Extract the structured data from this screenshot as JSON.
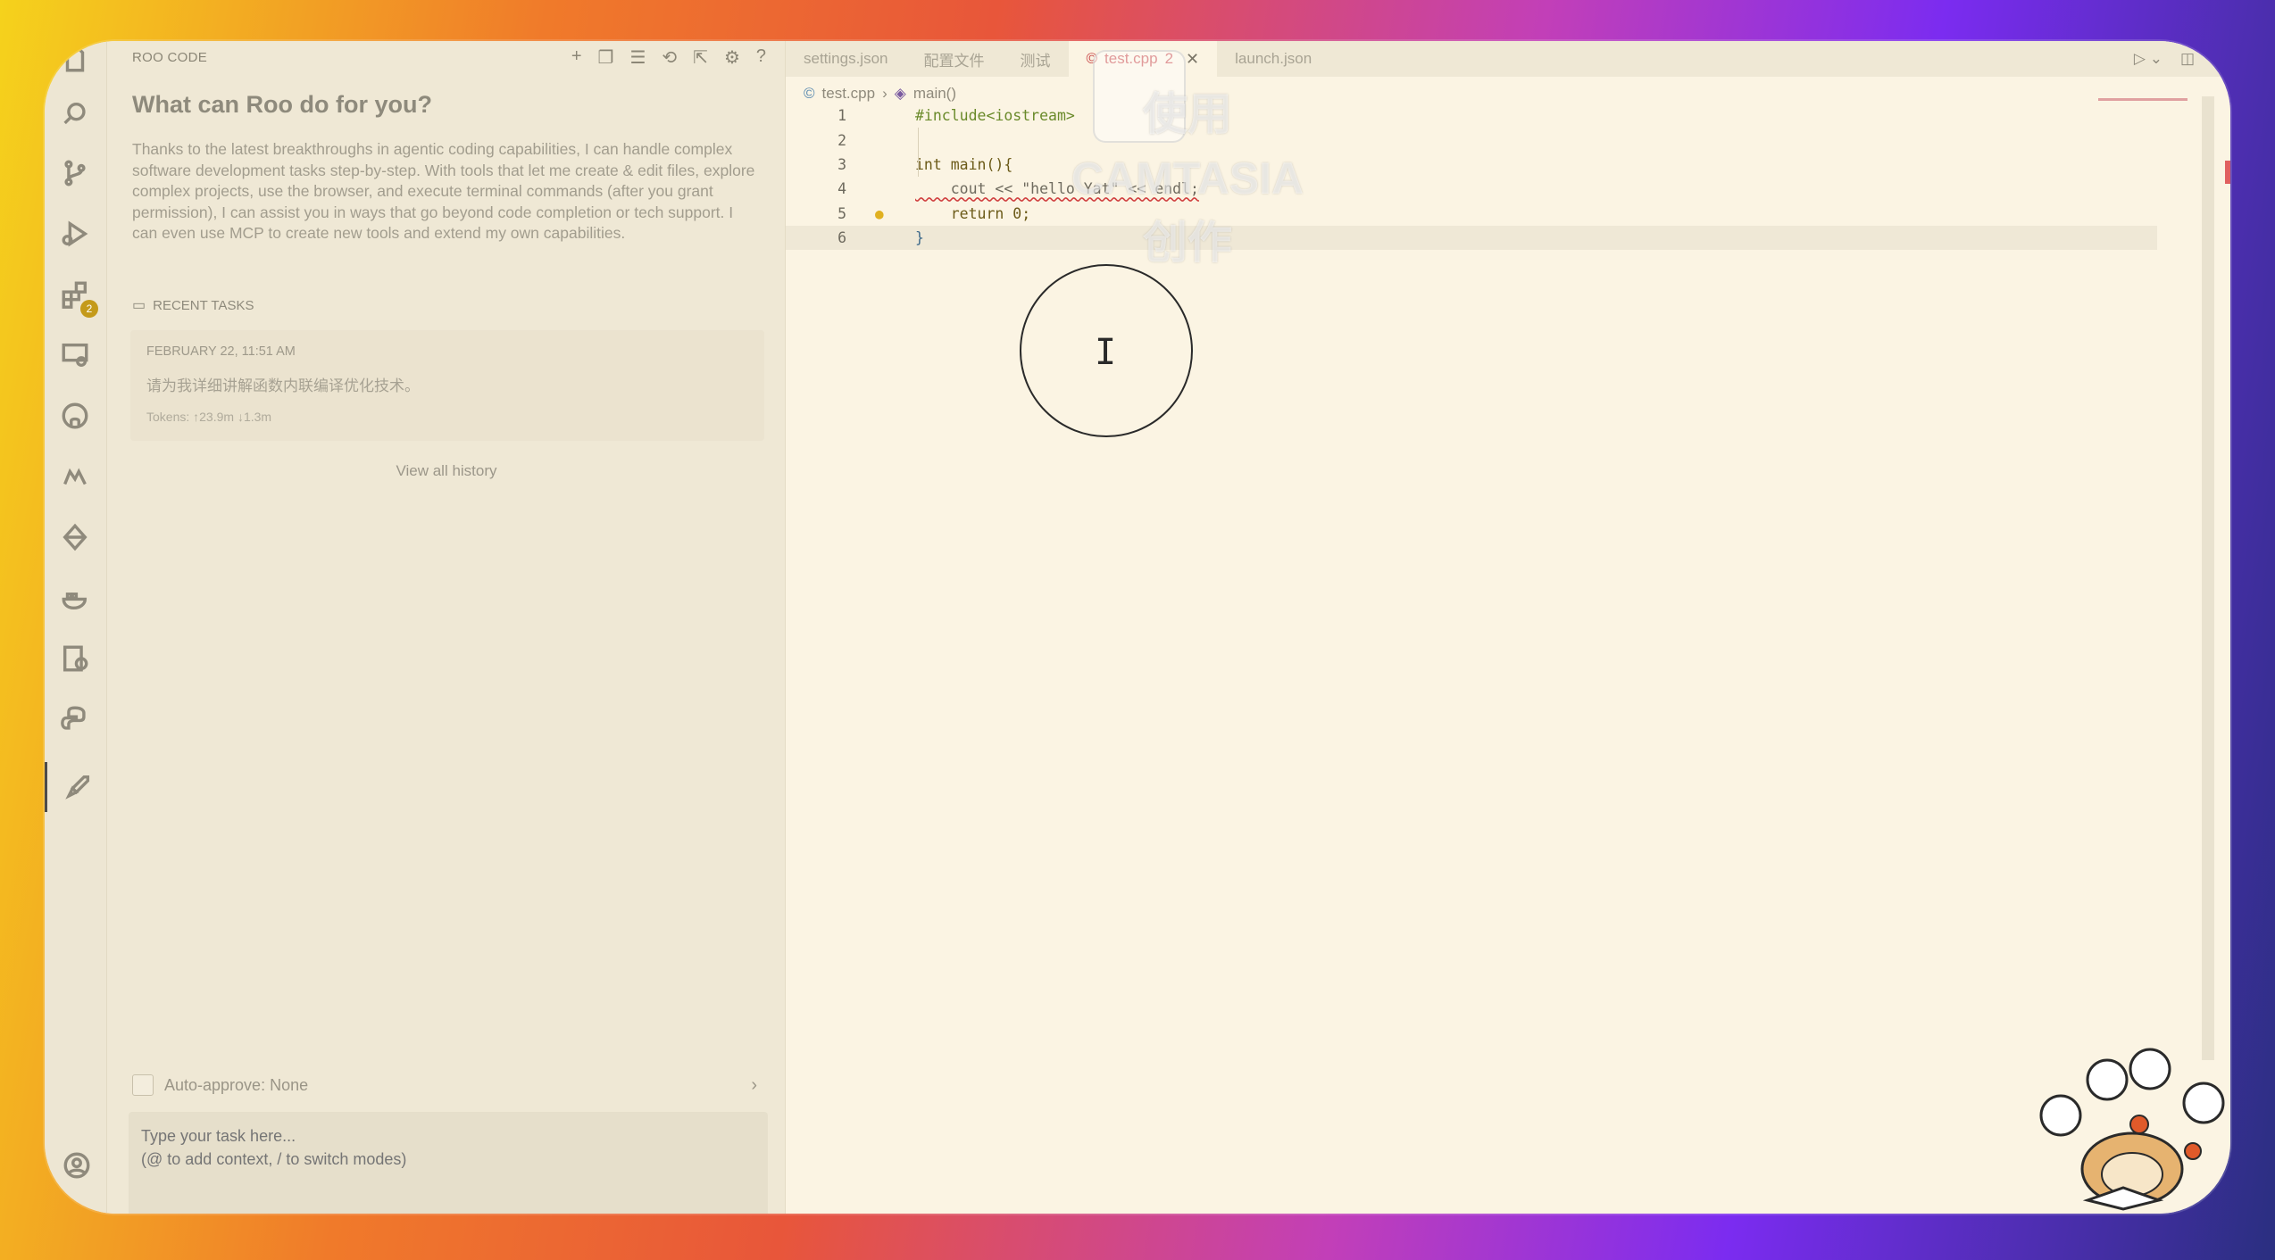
{
  "panel": {
    "title": "ROO CODE",
    "welcome_title": "What can Roo do for you?",
    "welcome_body": "Thanks to the latest breakthroughs in agentic coding capabilities, I can handle complex software development tasks step-by-step. With tools that let me create & edit files, explore complex projects, use the browser, and execute terminal commands (after you grant permission), I can assist you in ways that go beyond code completion or tech support. I can even use MCP to create new tools and extend my own capabilities.",
    "recent_label": "RECENT TASKS",
    "task": {
      "date": "FEBRUARY 22, 11:51 AM",
      "text": "请为我详细讲解函数内联编译优化技术。",
      "tokens": "Tokens: ↑23.9m ↓1.3m"
    },
    "history_link": "View all history",
    "auto_approve": "Auto-approve: None",
    "input_placeholder": "Type your task here...\n(@ to add context, / to switch modes)",
    "activity_badge": "2"
  },
  "editor": {
    "tabs": [
      {
        "label": "settings.json"
      },
      {
        "label": "配置文件"
      },
      {
        "label": "测试"
      },
      {
        "label": "test.cpp",
        "count": "2"
      },
      {
        "label": "launch.json"
      }
    ],
    "breadcrumb": {
      "file": "test.cpp",
      "symbol": "main()"
    },
    "lines": [
      {
        "num": "1",
        "text": "#include<iostream>"
      },
      {
        "num": "2",
        "text": ""
      },
      {
        "num": "3",
        "text": "int main(){"
      },
      {
        "num": "4",
        "text": "    cout << \"hello Yat\" << endl;"
      },
      {
        "num": "5",
        "text": "    return 0;"
      },
      {
        "num": "6",
        "text": "}"
      }
    ]
  },
  "overlay": {
    "watermark": [
      "使用",
      "CAMTASIA",
      "创作"
    ]
  },
  "colors": {
    "accent_tab": "#c94a4a",
    "background": "#fbf4e3",
    "badge": "#c49a1a"
  }
}
